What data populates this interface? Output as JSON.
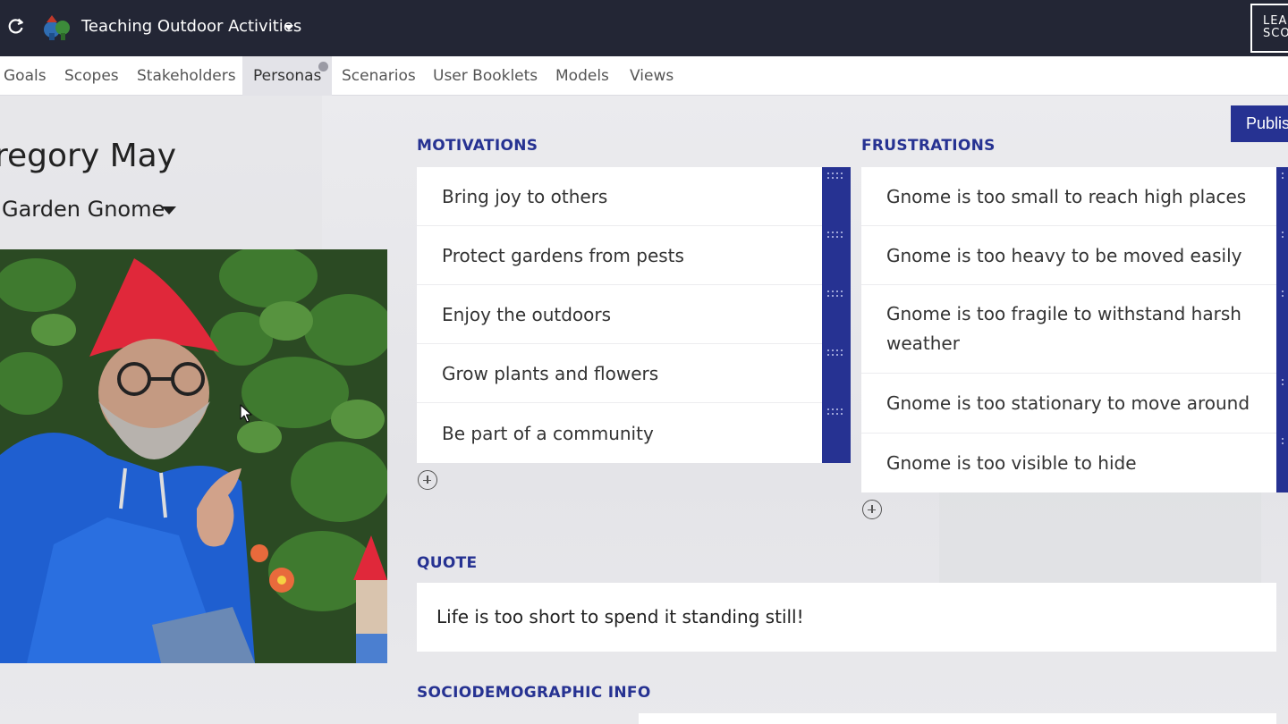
{
  "topbar": {
    "project_title": "Teaching Outdoor Activities",
    "logo_text_line1": "LEA",
    "logo_text_line2": "SCO",
    "icons": {
      "refresh": "refresh-icon",
      "project": "project-avatar-icon",
      "dropdown": "caret-down-icon"
    }
  },
  "tabs": [
    {
      "label": "Goals",
      "active": false
    },
    {
      "label": "Scopes",
      "active": false
    },
    {
      "label": "Stakeholders",
      "active": false
    },
    {
      "label": "Personas",
      "active": true
    },
    {
      "label": "Scenarios",
      "active": false
    },
    {
      "label": "User Booklets",
      "active": false
    },
    {
      "label": "Models",
      "active": false
    },
    {
      "label": "Views",
      "active": false
    }
  ],
  "actions": {
    "publish_label": "Publish"
  },
  "persona": {
    "name": "regory May",
    "type": "Garden Gnome"
  },
  "motivations": {
    "title": "MOTIVATIONS",
    "items": [
      "Bring joy to others",
      "Protect gardens from pests",
      "Enjoy the outdoors",
      "Grow plants and flowers",
      "Be part of a community"
    ]
  },
  "frustrations": {
    "title": "FRUSTRATIONS",
    "items": [
      "Gnome is too small to reach high places",
      "Gnome is too heavy to be moved easily",
      "Gnome is too fragile to withstand harsh weather",
      "Gnome is too stationary to move around",
      "Gnome is too visible to hide"
    ]
  },
  "quote": {
    "title": "QUOTE",
    "text": "Life is too short to spend it standing still!"
  },
  "sociodemographic": {
    "title": "SOCIODEMOGRAPHIC INFO"
  },
  "colors": {
    "topbar": "#232635",
    "accent": "#263292",
    "background": "#ececef",
    "card": "#ffffff"
  }
}
